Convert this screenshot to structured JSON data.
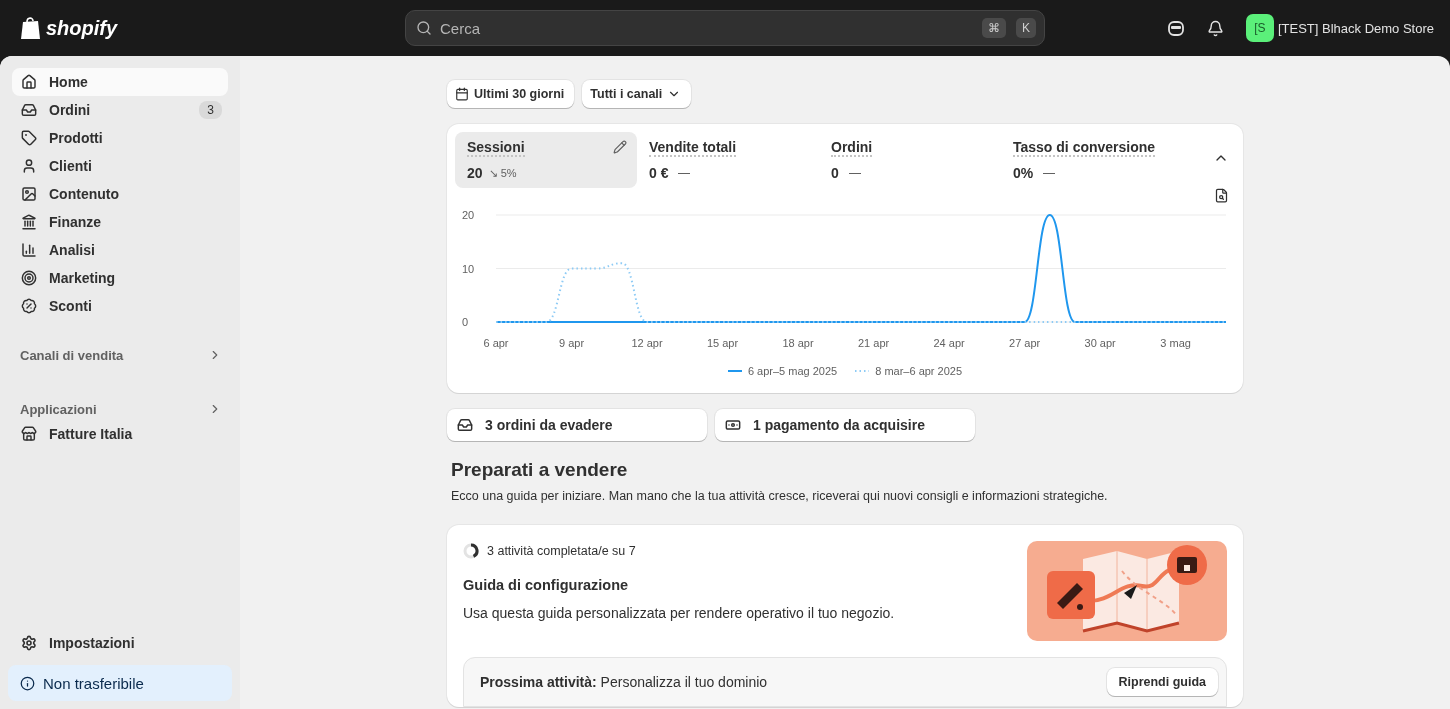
{
  "topbar": {
    "logo": "shopify",
    "search": {
      "placeholder": "Cerca",
      "shortcut": [
        "⌘",
        "K"
      ]
    },
    "store": {
      "initials": "[S",
      "name": "[TEST] Blhack Demo Store"
    }
  },
  "sidebar": {
    "items": [
      {
        "label": "Home",
        "selected": true
      },
      {
        "label": "Ordini",
        "selected": false,
        "badge": "3"
      },
      {
        "label": "Prodotti",
        "selected": false
      },
      {
        "label": "Clienti",
        "selected": false
      },
      {
        "label": "Contenuto",
        "selected": false
      },
      {
        "label": "Finanze",
        "selected": false
      },
      {
        "label": "Analisi",
        "selected": false
      },
      {
        "label": "Marketing",
        "selected": false
      },
      {
        "label": "Sconti",
        "selected": false
      }
    ],
    "sections": [
      {
        "title": "Canali di vendita"
      },
      {
        "title": "Applicazioni",
        "items": [
          {
            "label": "Fatture Italia",
            "selected": false
          }
        ]
      }
    ],
    "settings": {
      "label": "Impostazioni"
    },
    "notice": "Non trasferibile"
  },
  "filters": [
    {
      "label": "Ultimi 30 giorni",
      "kind": "date"
    },
    {
      "label": "Tutti i canali",
      "kind": "dropdown"
    }
  ],
  "metrics": [
    {
      "label": "Sessioni",
      "value": "20",
      "change": "↘ 5%",
      "selected": true
    },
    {
      "label": "Vendite totali",
      "value": "0 €",
      "selected": false
    },
    {
      "label": "Ordini",
      "value": "0",
      "selected": false
    },
    {
      "label": "Tasso di conversione",
      "value": "0%",
      "selected": false
    }
  ],
  "chart_data": {
    "type": "line",
    "categories": [
      "6 apr",
      null,
      null,
      "9 apr",
      null,
      null,
      "12 apr",
      null,
      null,
      "15 apr",
      null,
      null,
      "18 apr",
      null,
      null,
      "21 apr",
      null,
      null,
      "24 apr",
      null,
      null,
      "27 apr",
      null,
      null,
      "30 apr",
      null,
      null,
      "3 mag",
      null,
      null
    ],
    "yticks": [
      0,
      10,
      20
    ],
    "ylim": [
      0,
      20
    ],
    "series": [
      {
        "name": "6 apr–5 mag 2025",
        "color": "#1f97ee",
        "line_style": "solid",
        "values": [
          0,
          0,
          0,
          0,
          0,
          0,
          0,
          0,
          0,
          0,
          0,
          0,
          0,
          0,
          0,
          0,
          0,
          0,
          0,
          0,
          0,
          0,
          20,
          0,
          0,
          0,
          0,
          0,
          0,
          0
        ]
      },
      {
        "name": "8 mar–6 apr 2025",
        "color": "#8ecbf5",
        "line_style": "dotted",
        "values": [
          0,
          0,
          0,
          10,
          10,
          11,
          0,
          0,
          0,
          0,
          0,
          0,
          0,
          0,
          0,
          0,
          0,
          0,
          0,
          0,
          0,
          0,
          0,
          0,
          0,
          0,
          0,
          0,
          0,
          0
        ]
      }
    ]
  },
  "tasks": [
    {
      "label": "3 ordini da evadere"
    },
    {
      "label": "1 pagamento da acquisire"
    }
  ],
  "setup": {
    "title": "Preparati a vendere",
    "intro": "Ecco una guida per iniziare. Man mano che la tua attività cresce, riceverai qui nuovi consigli e informazioni strategiche.",
    "progress": "3 attività completata/e su 7",
    "level": 0.43,
    "card_title": "Guida di configurazione",
    "card_text": "Usa questa guida personalizzata per rendere operativo il tuo negozio.",
    "next": "**Prossima attività:** Personalizza il tuo dominio",
    "button": "Riprendi guida"
  }
}
